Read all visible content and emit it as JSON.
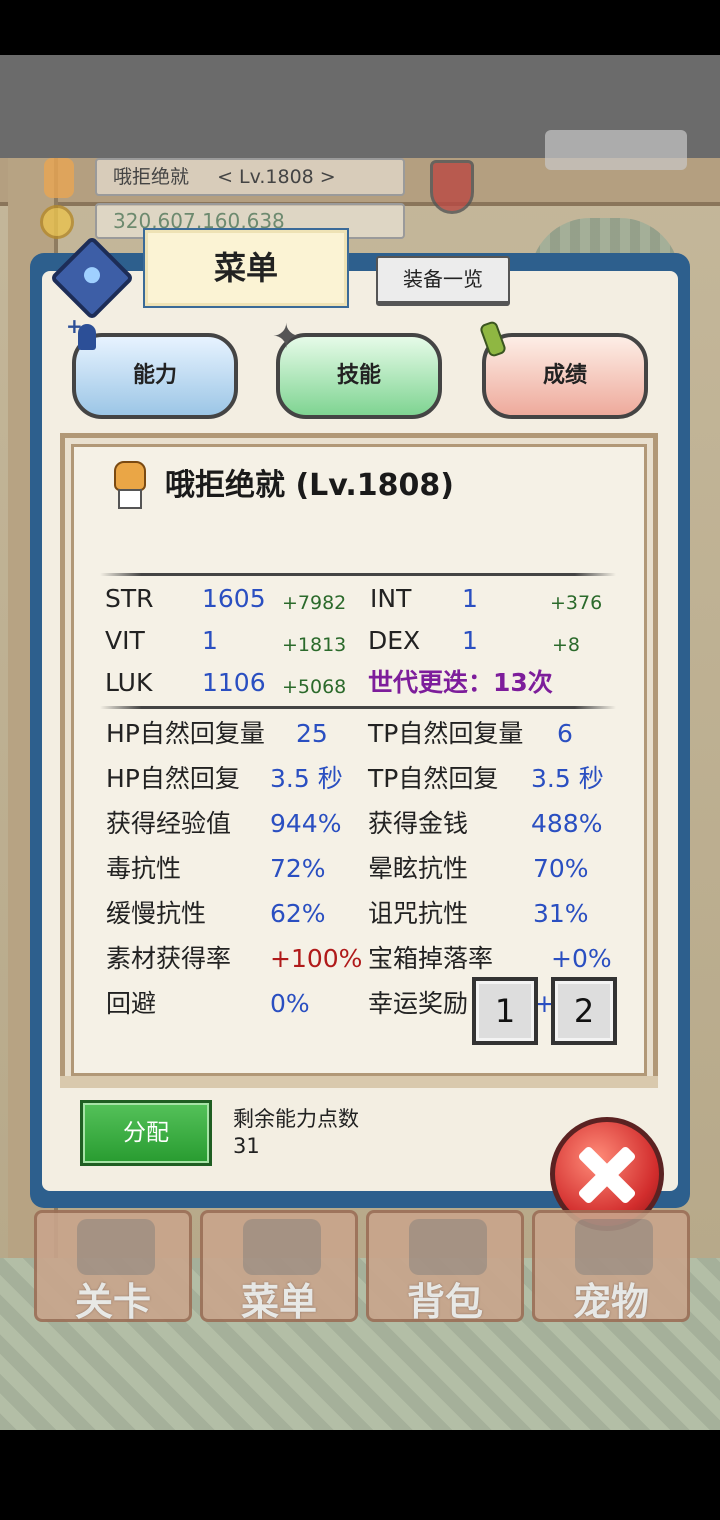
{
  "hud": {
    "player_name": "哦拒绝就",
    "player_level": "< Lv.1808 >",
    "gold": "320,607,160,638"
  },
  "menu": {
    "tab_title": "菜单",
    "equip_list_label": "装备一览",
    "categories": [
      "能力",
      "技能",
      "成绩"
    ]
  },
  "character": {
    "name": "哦拒绝就 (Lv.1808)"
  },
  "stats": {
    "str": {
      "label": "STR",
      "value": "1605",
      "bonus": "+7982"
    },
    "int": {
      "label": "INT",
      "value": "1",
      "bonus": "+376"
    },
    "vit": {
      "label": "VIT",
      "value": "1",
      "bonus": "+1813"
    },
    "dex": {
      "label": "DEX",
      "value": "1",
      "bonus": "+8"
    },
    "luk": {
      "label": "LUK",
      "value": "1106",
      "bonus": "+5068"
    },
    "generation": "世代更迭：13次"
  },
  "details": [
    {
      "label": "HP自然回复量",
      "value": "25"
    },
    {
      "label": "TP自然回复量",
      "value": "6"
    },
    {
      "label": "HP自然回复",
      "value": "3.5 秒"
    },
    {
      "label": "TP自然回复",
      "value": "3.5 秒"
    },
    {
      "label": "获得经验值",
      "value": "944%"
    },
    {
      "label": "获得金钱",
      "value": "488%"
    },
    {
      "label": "毒抗性",
      "value": "72%"
    },
    {
      "label": "晕眩抗性",
      "value": "70%"
    },
    {
      "label": "缓慢抗性",
      "value": "62%"
    },
    {
      "label": "诅咒抗性",
      "value": "31%"
    },
    {
      "label": "素材获得率",
      "value": "+100%"
    },
    {
      "label": "宝箱掉落率",
      "value": "+0%"
    },
    {
      "label": "回避",
      "value": "0%"
    },
    {
      "label": "幸运奖励",
      "value": "+24%"
    }
  ],
  "pages": [
    "1",
    "2"
  ],
  "assign": {
    "button_label": "分配",
    "remaining_label": "剩余能力点数",
    "remaining_value": "31"
  },
  "bottom_nav": [
    "关卡",
    "菜单",
    "背包",
    "宠物"
  ]
}
